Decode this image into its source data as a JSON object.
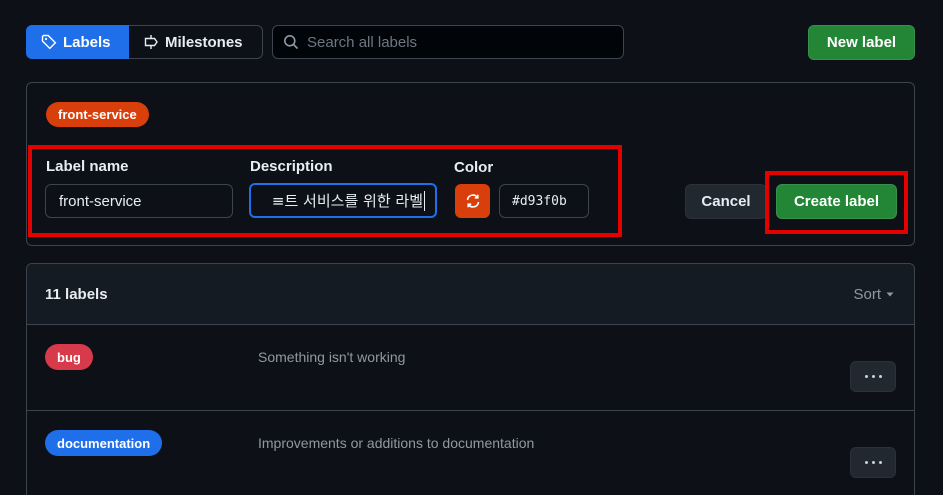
{
  "subnav": {
    "labels_tab": "Labels",
    "milestones_tab": "Milestones"
  },
  "search": {
    "placeholder": "Search all labels"
  },
  "new_label_button": "New label",
  "editor": {
    "preview_name": "front-service",
    "preview_color": "#d93f0b",
    "name_label": "Label name",
    "name_value": "front-service",
    "description_label": "Description",
    "description_value": "≡트 서비스를 위한 라벨",
    "color_label": "Color",
    "color_value": "#d93f0b",
    "cancel_button": "Cancel",
    "create_button": "Create label"
  },
  "list": {
    "count": "11 labels",
    "sort_label": "Sort",
    "rows": [
      {
        "name": "bug",
        "color": "#d73a4a",
        "description": "Something isn't working"
      },
      {
        "name": "documentation",
        "color": "#0075ca",
        "description": "Improvements or additions to documentation"
      }
    ]
  },
  "colors": {
    "accent": "#1f6feb",
    "primary_button": "#238636",
    "highlight_box": "#e50000",
    "background": "#0d1117"
  }
}
